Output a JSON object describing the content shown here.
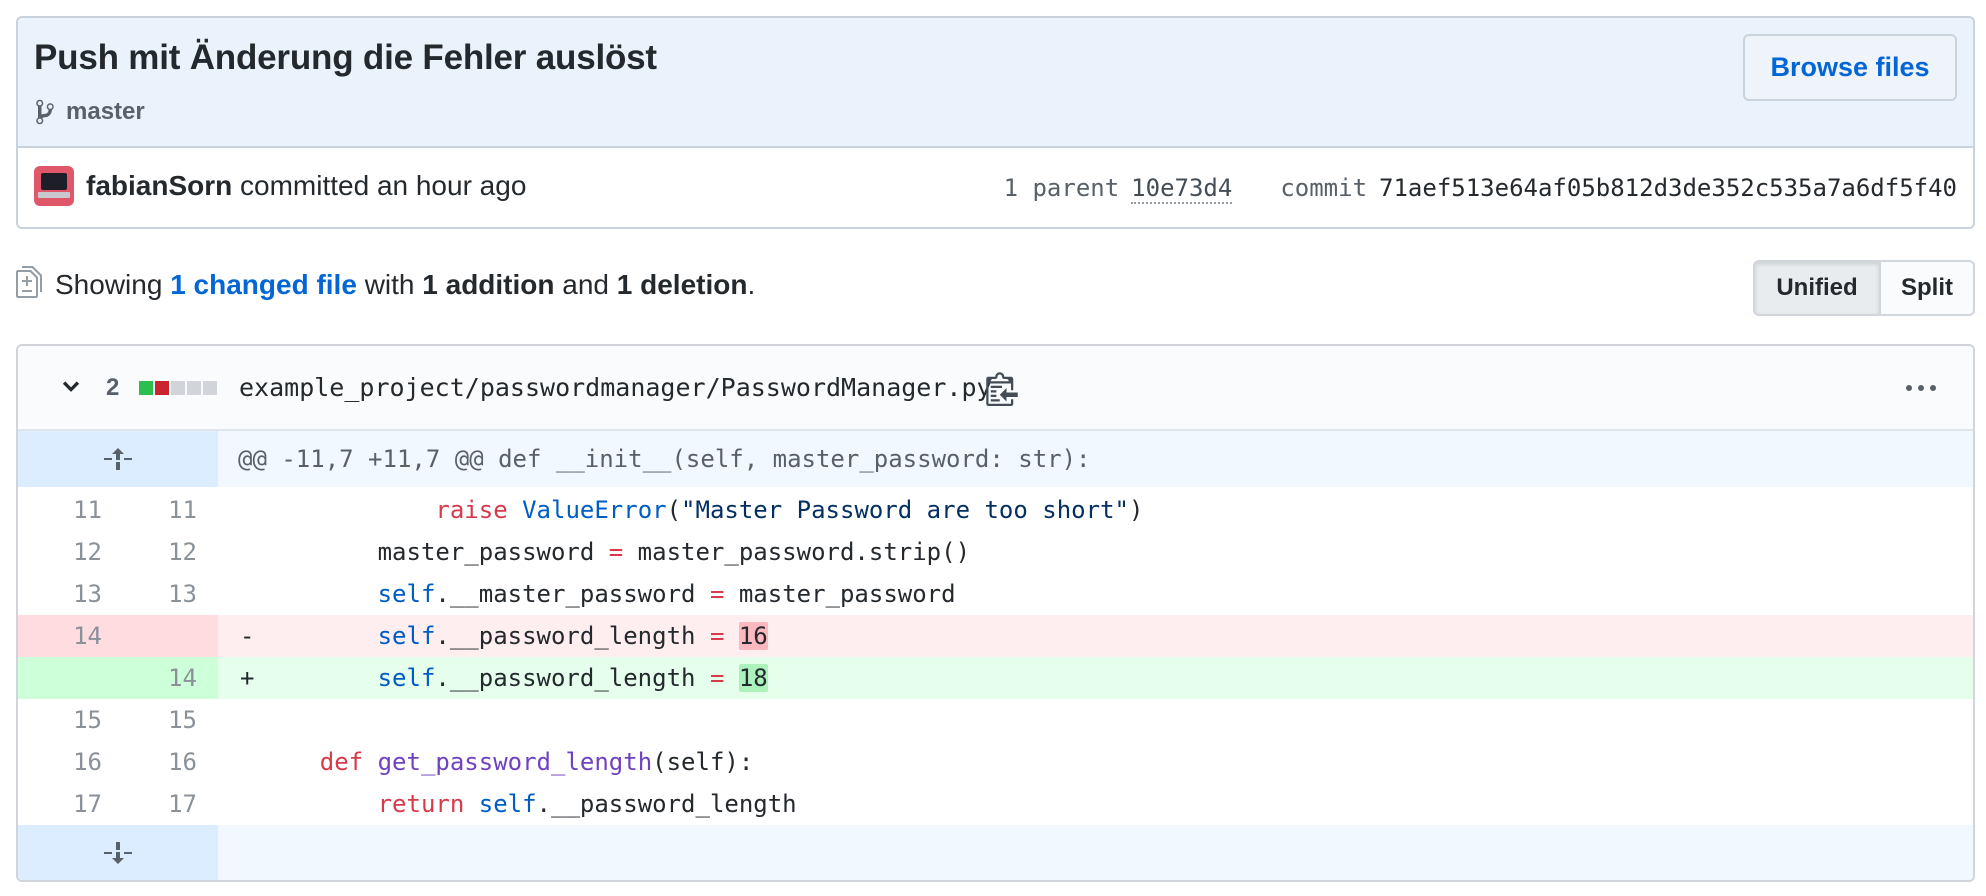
{
  "commit": {
    "title": "Push mit Änderung die Fehler auslöst",
    "branch": "master",
    "browse_files_label": "Browse files",
    "author": "fabianSorn",
    "committed_text": "committed an hour ago",
    "parent_label": "1 parent",
    "parent_sha": "10e73d4",
    "commit_label": "commit",
    "commit_sha": "71aef513e64af05b812d3de352c535a7a6df5f40"
  },
  "toc": {
    "showing": "Showing",
    "changed_files": "1 changed file",
    "with": "with",
    "additions": "1 addition",
    "and": "and",
    "deletions": "1 deletion",
    "period": ".",
    "unified_label": "Unified",
    "split_label": "Split"
  },
  "file": {
    "change_count": "2",
    "diffstat": [
      "add",
      "del",
      "neutral",
      "neutral",
      "neutral"
    ],
    "path": "example_project/passwordmanager/PasswordManager.py",
    "hunk_header": "@@ -11,7 +11,7 @@ def __init__(self, master_password: str):",
    "lines": [
      {
        "type": "ctx",
        "old": "11",
        "new": "11",
        "sign": " ",
        "tokens": [
          [
            "",
            "            "
          ],
          [
            "kw",
            "raise"
          ],
          [
            "",
            " "
          ],
          [
            "cls",
            "ValueError"
          ],
          [
            "",
            "("
          ],
          [
            "str",
            "\"Master Password are too short\""
          ],
          [
            "",
            ")"
          ]
        ]
      },
      {
        "type": "ctx",
        "old": "12",
        "new": "12",
        "sign": " ",
        "tokens": [
          [
            "",
            "        master_password "
          ],
          [
            "op",
            "="
          ],
          [
            "",
            " master_password.strip()"
          ]
        ]
      },
      {
        "type": "ctx",
        "old": "13",
        "new": "13",
        "sign": " ",
        "tokens": [
          [
            "",
            "        "
          ],
          [
            "self",
            "self"
          ],
          [
            "",
            ".__master_password "
          ],
          [
            "op",
            "="
          ],
          [
            "",
            " master_password"
          ]
        ]
      },
      {
        "type": "del",
        "old": "14",
        "new": "",
        "sign": "-",
        "tokens": [
          [
            "",
            "        "
          ],
          [
            "self",
            "self"
          ],
          [
            "",
            ".__password_length "
          ],
          [
            "op",
            "="
          ],
          [
            "",
            " "
          ],
          [
            "hl-del",
            "16"
          ]
        ]
      },
      {
        "type": "add",
        "old": "",
        "new": "14",
        "sign": "+",
        "tokens": [
          [
            "",
            "        "
          ],
          [
            "self",
            "self"
          ],
          [
            "",
            ".__password_length "
          ],
          [
            "op",
            "="
          ],
          [
            "",
            " "
          ],
          [
            "hl-add",
            "18"
          ]
        ]
      },
      {
        "type": "ctx",
        "old": "15",
        "new": "15",
        "sign": " ",
        "tokens": []
      },
      {
        "type": "ctx",
        "old": "16",
        "new": "16",
        "sign": " ",
        "tokens": [
          [
            "",
            "    "
          ],
          [
            "kw",
            "def"
          ],
          [
            "",
            " "
          ],
          [
            "fn",
            "get_password_length"
          ],
          [
            "",
            "(self):"
          ]
        ]
      },
      {
        "type": "ctx",
        "old": "17",
        "new": "17",
        "sign": " ",
        "tokens": [
          [
            "",
            "        "
          ],
          [
            "kw",
            "return"
          ],
          [
            "",
            " "
          ],
          [
            "self",
            "self"
          ],
          [
            "",
            ".__password_length"
          ]
        ]
      }
    ]
  },
  "colors": {
    "accent": "#0366d6",
    "diff_add": "#2cbe4e",
    "diff_del": "#cb2431",
    "diff_neutral": "#d1d5da"
  }
}
